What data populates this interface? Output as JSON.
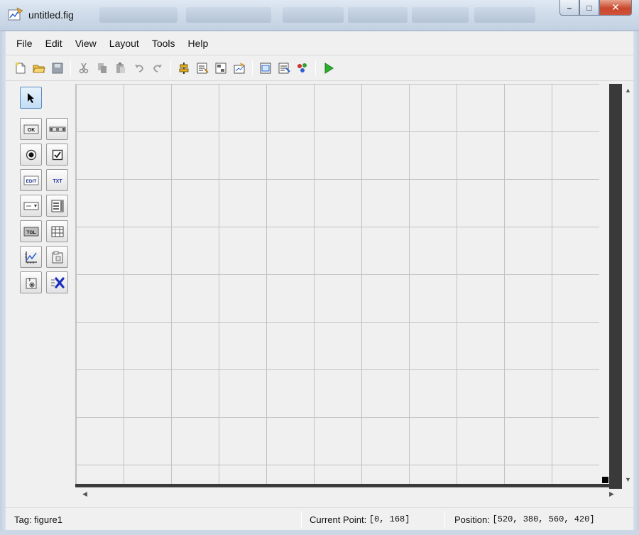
{
  "window": {
    "title": "untitled.fig",
    "controls": {
      "minimize": "–",
      "maximize": "□",
      "close": "✕"
    }
  },
  "menu": [
    "File",
    "Edit",
    "View",
    "Layout",
    "Tools",
    "Help"
  ],
  "toolbar": {
    "buttons": [
      "new-icon",
      "open-icon",
      "save-icon",
      "cut-icon",
      "copy-icon",
      "paste-icon",
      "undo-icon",
      "redo-icon",
      "align-objects-icon",
      "menu-editor-icon",
      "tab-order-editor-icon",
      "toolbar-editor-icon",
      "editor-icon",
      "property-inspector-icon",
      "object-browser-icon",
      "run-figure-icon"
    ]
  },
  "palette": {
    "tools": [
      {
        "name": "select-tool",
        "label": ""
      },
      {
        "name": "push-button-tool",
        "label": "OK"
      },
      {
        "name": "slider-tool",
        "label": ""
      },
      {
        "name": "radio-button-tool",
        "label": ""
      },
      {
        "name": "check-box-tool",
        "label": ""
      },
      {
        "name": "edit-text-tool",
        "label": "EDIT"
      },
      {
        "name": "static-text-tool",
        "label": "TXT"
      },
      {
        "name": "popup-menu-tool",
        "label": ""
      },
      {
        "name": "listbox-tool",
        "label": ""
      },
      {
        "name": "toggle-button-tool",
        "label": "TGL"
      },
      {
        "name": "table-tool",
        "label": ""
      },
      {
        "name": "axes-tool",
        "label": ""
      },
      {
        "name": "panel-tool",
        "label": ""
      },
      {
        "name": "button-group-tool",
        "label": ""
      },
      {
        "name": "activex-control-tool",
        "label": ""
      }
    ]
  },
  "status": {
    "tag": "Tag: figure1",
    "current_point_label": "Current Point:",
    "current_point_value": "[0, 168]",
    "position_label": "Position:",
    "position_value": "[520, 380, 560, 420]"
  }
}
